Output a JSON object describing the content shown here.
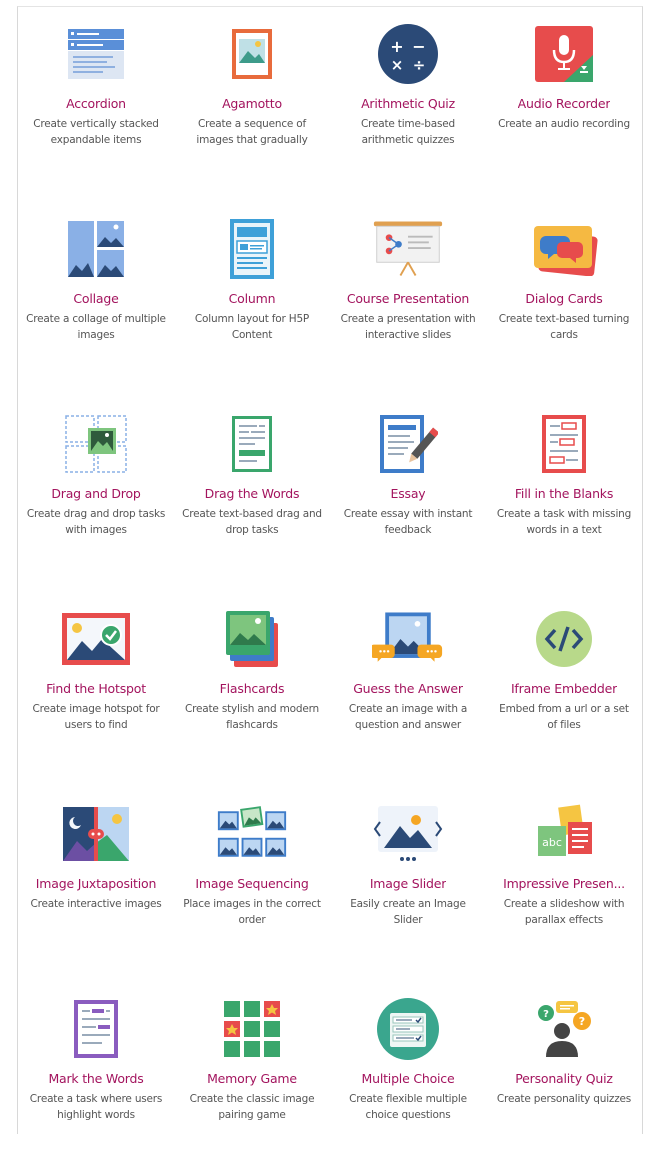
{
  "colors": {
    "title": "#a3145e",
    "description": "#555555"
  },
  "content_types": [
    {
      "title": "Accordion",
      "description": "Create vertically stacked expandable items",
      "icon": "accordion-icon"
    },
    {
      "title": "Agamotto",
      "description": "Create a sequence of images that gradually",
      "icon": "agamotto-icon"
    },
    {
      "title": "Arithmetic Quiz",
      "description": "Create time-based arithmetic quizzes",
      "icon": "arithmetic-quiz-icon"
    },
    {
      "title": "Audio Recorder",
      "description": "Create an audio recording",
      "icon": "audio-recorder-icon"
    },
    {
      "title": "Collage",
      "description": "Create a collage of multiple images",
      "icon": "collage-icon"
    },
    {
      "title": "Column",
      "description": "Column layout for H5P Content",
      "icon": "column-icon"
    },
    {
      "title": "Course Presentation",
      "description": "Create a presentation with interactive slides",
      "icon": "course-presentation-icon"
    },
    {
      "title": "Dialog Cards",
      "description": "Create text-based turning cards",
      "icon": "dialog-cards-icon"
    },
    {
      "title": "Drag and Drop",
      "description": "Create drag and drop tasks with images",
      "icon": "drag-and-drop-icon"
    },
    {
      "title": "Drag the Words",
      "description": "Create text-based drag and drop tasks",
      "icon": "drag-the-words-icon"
    },
    {
      "title": "Essay",
      "description": "Create essay with instant feedback",
      "icon": "essay-icon"
    },
    {
      "title": "Fill in the Blanks",
      "description": "Create a task with missing words in a text",
      "icon": "fill-in-the-blanks-icon"
    },
    {
      "title": "Find the Hotspot",
      "description": "Create image hotspot for users to find",
      "icon": "find-the-hotspot-icon"
    },
    {
      "title": "Flashcards",
      "description": "Create stylish and modern flashcards",
      "icon": "flashcards-icon"
    },
    {
      "title": "Guess the Answer",
      "description": "Create an image with a question and answer",
      "icon": "guess-the-answer-icon"
    },
    {
      "title": "Iframe Embedder",
      "description": "Embed from a url or a set of files",
      "icon": "iframe-embedder-icon"
    },
    {
      "title": "Image Juxtaposition",
      "description": "Create interactive images",
      "icon": "image-juxtaposition-icon"
    },
    {
      "title": "Image Sequencing",
      "description": "Place images in the correct order",
      "icon": "image-sequencing-icon"
    },
    {
      "title": "Image Slider",
      "description": "Easily create an Image Slider",
      "icon": "image-slider-icon"
    },
    {
      "title": "Impressive Presen...",
      "description": "Create a slideshow with parallax effects",
      "icon": "impressive-presentation-icon"
    },
    {
      "title": "Mark the Words",
      "description": "Create a task where users highlight words",
      "icon": "mark-the-words-icon"
    },
    {
      "title": "Memory Game",
      "description": "Create the classic image pairing game",
      "icon": "memory-game-icon"
    },
    {
      "title": "Multiple Choice",
      "description": "Create flexible multiple choice questions",
      "icon": "multiple-choice-icon"
    },
    {
      "title": "Personality Quiz",
      "description": "Create personality quizzes",
      "icon": "personality-quiz-icon"
    }
  ]
}
